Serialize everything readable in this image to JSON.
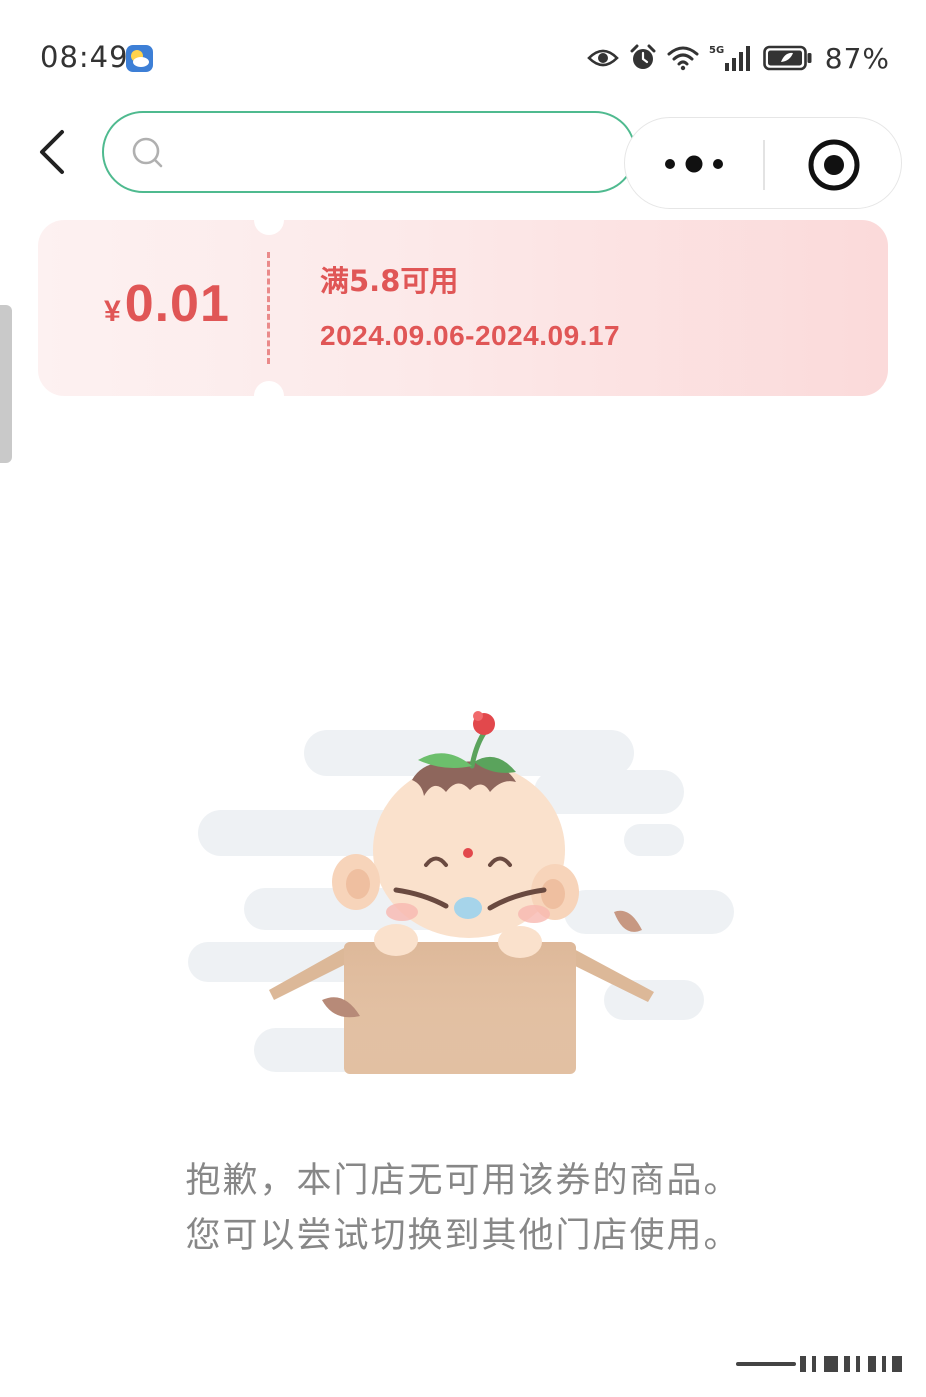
{
  "status_bar": {
    "time": "08:49",
    "network": "5G",
    "battery": "87%"
  },
  "search": {
    "placeholder": "",
    "value": ""
  },
  "capsule": {
    "menu_icon": "more-dots-icon",
    "close_icon": "target-close-icon"
  },
  "coupon": {
    "currency": "¥",
    "amount": "0.01",
    "condition": "满5.8可用",
    "period": "2024.09.06-2024.09.17",
    "colors": {
      "accent": "#e05656",
      "background": "#fce9e9"
    }
  },
  "empty_state": {
    "illustration": "baby-in-box-illustration",
    "line1": "抱歉，本门店无可用该券的商品。",
    "line2": "您可以尝试切换到其他门店使用。"
  },
  "theme": {
    "search_border": "#4fba8f",
    "message_color": "#878787"
  }
}
